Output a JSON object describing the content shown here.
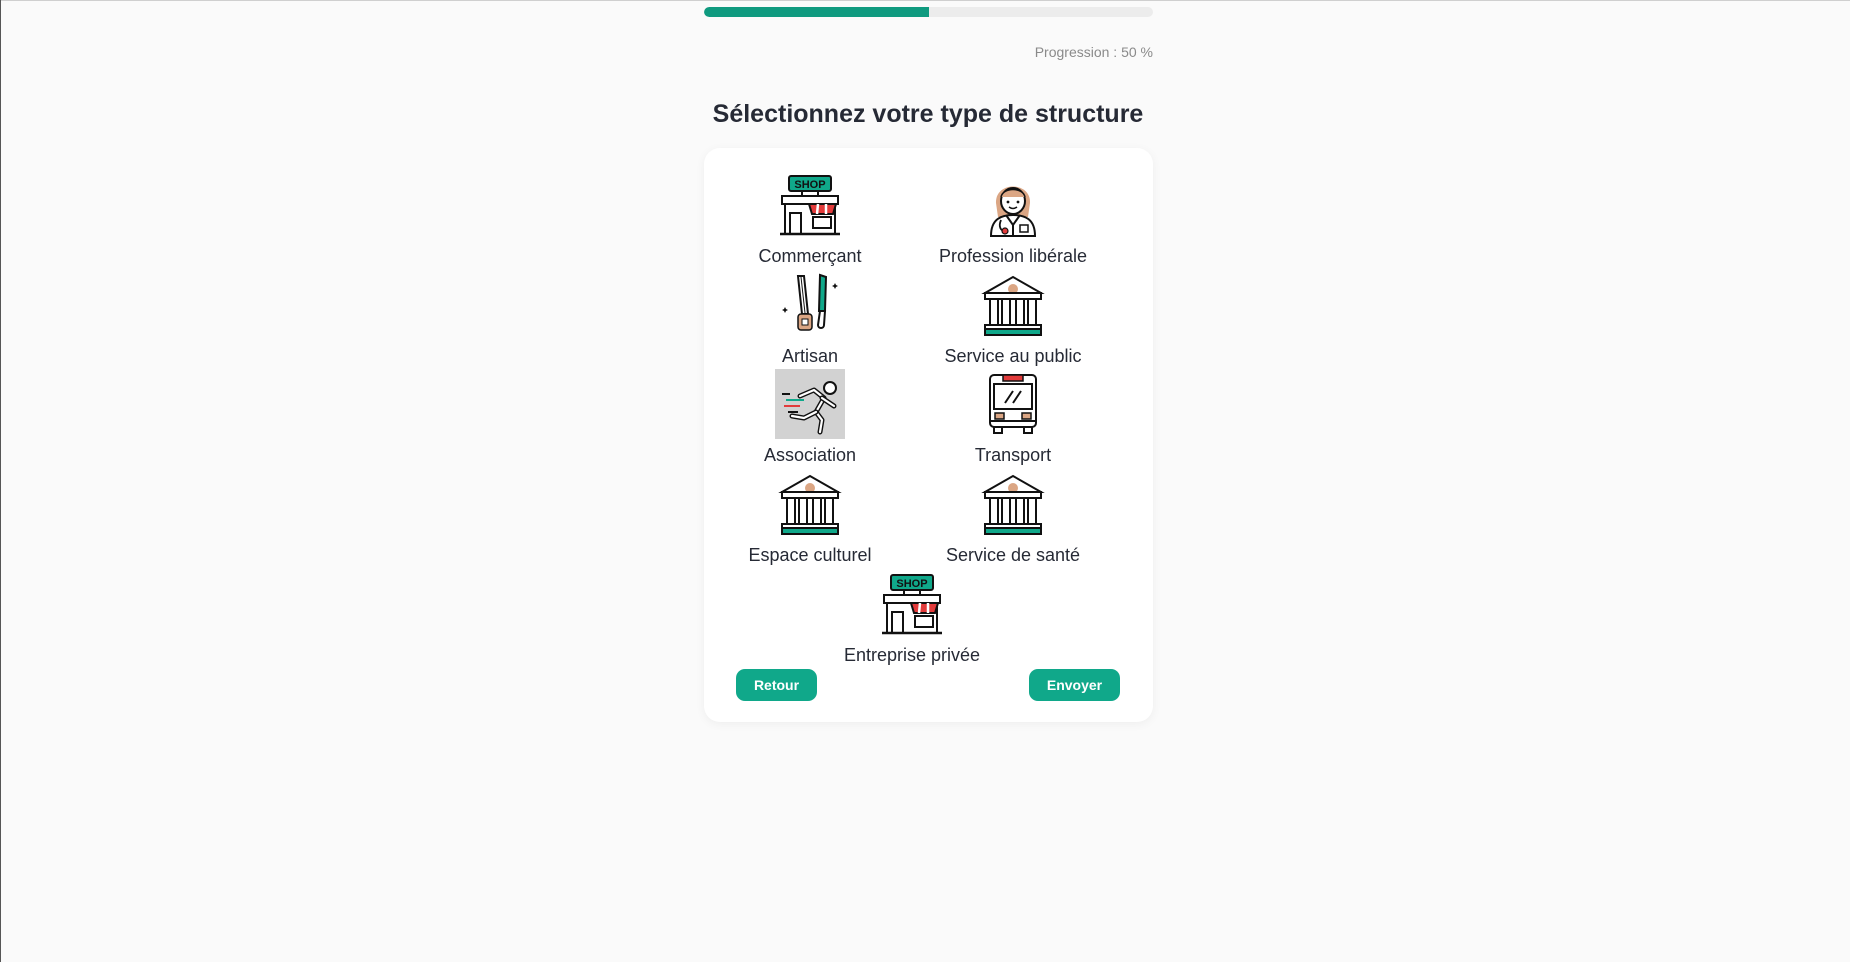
{
  "progress": {
    "label": "Progression : 50 %",
    "value": 0.5
  },
  "title": "Sélectionnez votre type de structure",
  "options": [
    {
      "label": "Commerçant",
      "icon": "shop-icon",
      "selected": false
    },
    {
      "label": "Profession libérale",
      "icon": "doctor-icon",
      "selected": false
    },
    {
      "label": "Artisan",
      "icon": "saw-icon",
      "selected": false
    },
    {
      "label": "Service au public",
      "icon": "public-building-icon",
      "selected": false
    },
    {
      "label": "Association",
      "icon": "runner-icon",
      "selected": true
    },
    {
      "label": "Transport",
      "icon": "bus-icon",
      "selected": false
    },
    {
      "label": "Espace culturel",
      "icon": "public-building-icon",
      "selected": false
    },
    {
      "label": "Service de santé",
      "icon": "public-building-icon",
      "selected": false
    },
    {
      "label": "Entreprise privée",
      "icon": "shop-icon",
      "selected": false
    }
  ],
  "shop_sign": "SHOP",
  "buttons": {
    "back": "Retour",
    "send": "Envoyer"
  },
  "colors": {
    "accent": "#10a88a",
    "progress": "#0f9a7f",
    "awning": "#e23b3b",
    "skin": "#dba684"
  }
}
